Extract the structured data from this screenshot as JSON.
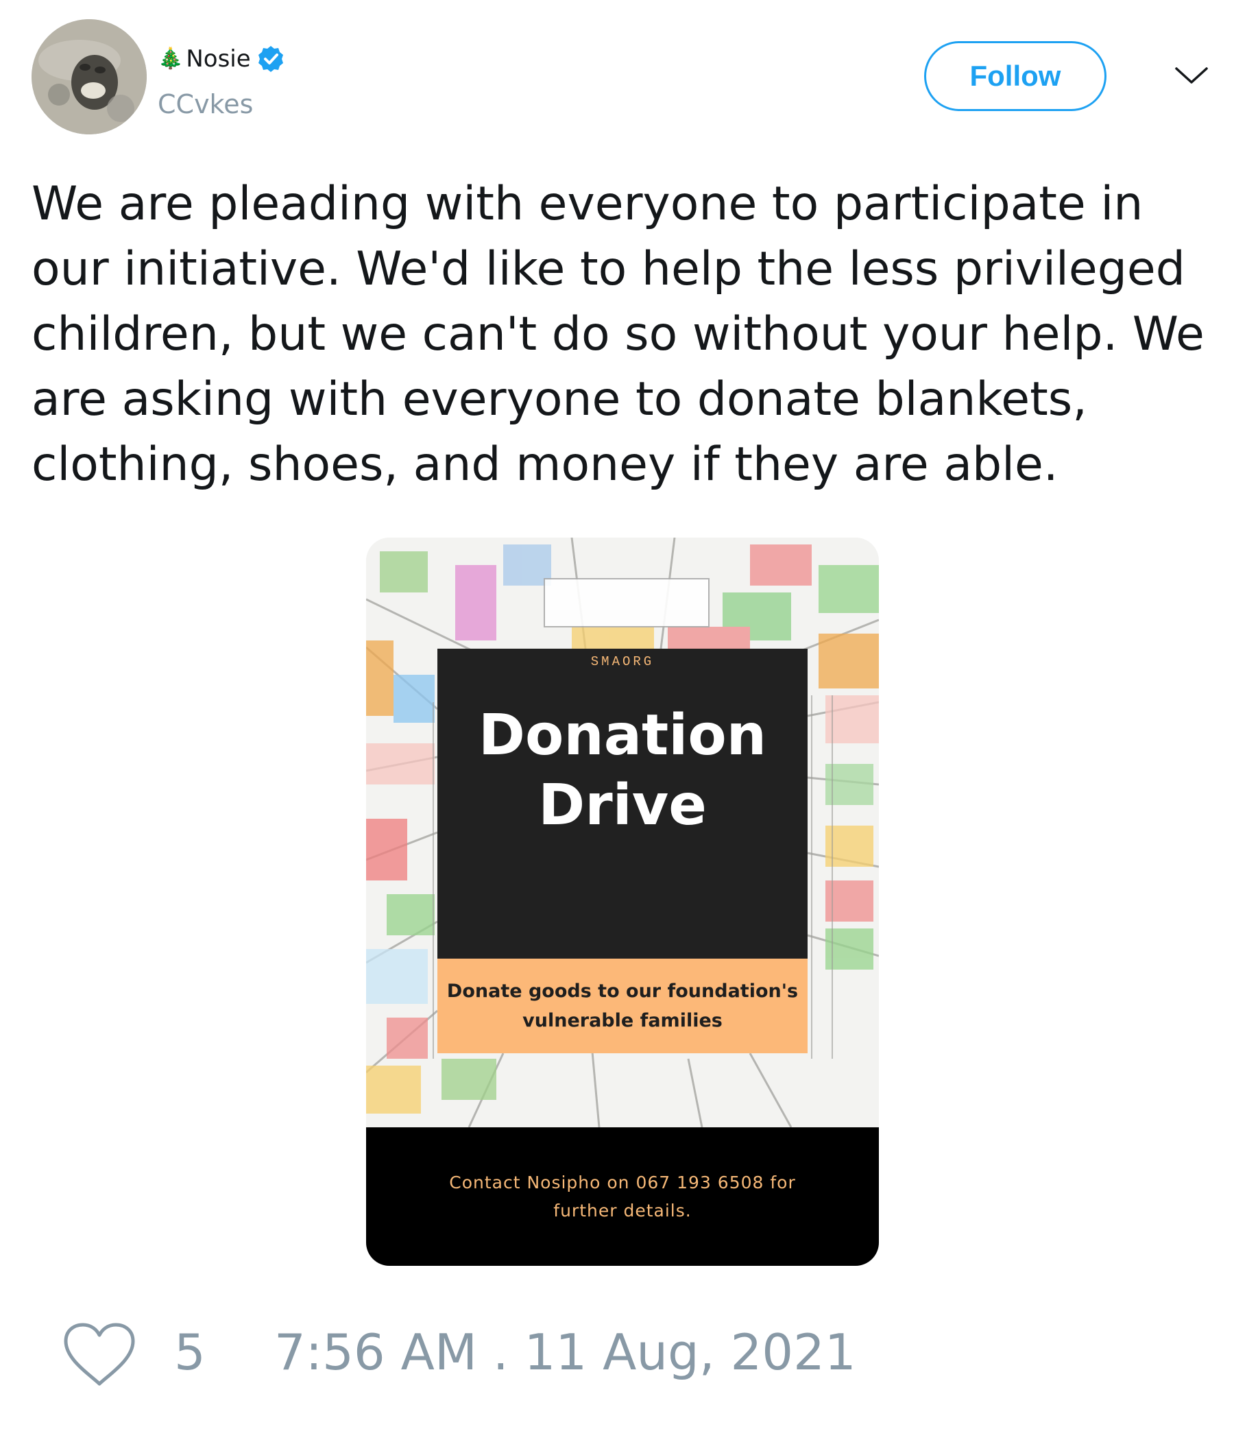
{
  "author": {
    "emoji": "🎄",
    "display_name": "Nosie",
    "verified": true,
    "handle": "CCvkes",
    "avatar_icon": "profile-photo"
  },
  "follow_button": {
    "label": "Follow"
  },
  "menu": {
    "icon": "chevron-down-icon"
  },
  "tweet": {
    "text": "We are pleading with everyone to participate in our initiative. We'd like to help the less privileged children, but we can't do so without your help. We are asking with everyone to donate blankets, clothing, shoes, and money if they are able."
  },
  "media": {
    "org": "SMAORG",
    "title_line1": "Donation",
    "title_line2": "Drive",
    "subtitle_line1": "Donate goods to our foundation's",
    "subtitle_line2": "vulnerable families",
    "contact": "Contact Nosipho on 067 193 6508 for further details."
  },
  "footer": {
    "like_icon": "heart-icon",
    "like_count": "5",
    "timestamp": "7:56 AM . 11 Aug, 2021"
  },
  "colors": {
    "accent": "#1da1f2",
    "muted": "#8899a6",
    "poster_orange": "#fcb878",
    "poster_dark": "#212121"
  }
}
